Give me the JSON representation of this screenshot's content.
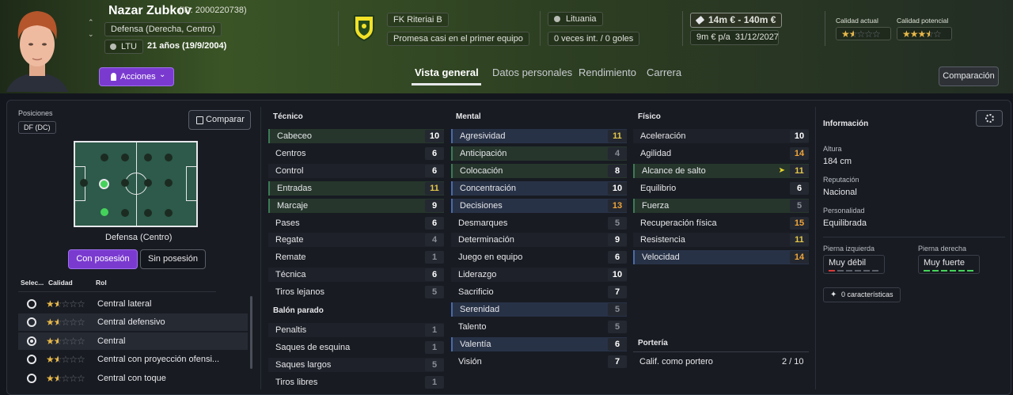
{
  "player": {
    "name": "Nazar Zubkov",
    "id": "(ID: 2000220738)",
    "position": "Defensa (Derecha, Centro)",
    "nation": "LTU",
    "age": "21 años (19/9/2004)",
    "actions": "Acciones"
  },
  "club": {
    "name": "FK Riteriai B",
    "status": "Promesa casi en el primer equipo"
  },
  "country": {
    "name": "Lituania",
    "caps": "0 veces int. / 0 goles"
  },
  "value": {
    "range": "14m € - 140m €",
    "wage": "9m € p/a",
    "expiry": "31/12/2027"
  },
  "ability": {
    "current_label": "Calidad actual",
    "current": 1.5,
    "potential_label": "Calidad potencial",
    "potential": 3.5
  },
  "tabs": [
    "Vista general",
    "Datos personales",
    "Rendimiento",
    "Carrera"
  ],
  "compare_btn": "Comparación",
  "left": {
    "positions_label": "Posiciones",
    "position_badge": "DF (DC)",
    "compare": "Comparar",
    "role_label": "Defensa (Centro)",
    "in_possession": "Con posesión",
    "out_possession": "Sin posesión",
    "cols": [
      "Selec...",
      "Calidad",
      "Rol"
    ],
    "roles": [
      {
        "name": "Central lateral",
        "stars": 1.5,
        "selected": false
      },
      {
        "name": "Central defensivo",
        "stars": 1.5,
        "selected": false
      },
      {
        "name": "Central",
        "stars": 1.5,
        "selected": true
      },
      {
        "name": "Central con proyección ofensi...",
        "stars": 1.5,
        "selected": false
      },
      {
        "name": "Central con toque",
        "stars": 1.5,
        "selected": false
      }
    ]
  },
  "technical": {
    "title": "Técnico",
    "attrs": [
      [
        "Cabeceo",
        10
      ],
      [
        "Centros",
        6
      ],
      [
        "Control",
        6
      ],
      [
        "Entradas",
        11
      ],
      [
        "Marcaje",
        9
      ],
      [
        "Pases",
        6
      ],
      [
        "Regate",
        4
      ],
      [
        "Remate",
        1
      ],
      [
        "Técnica",
        6
      ],
      [
        "Tiros lejanos",
        5
      ]
    ]
  },
  "setpieces": {
    "title": "Balón parado",
    "attrs": [
      [
        "Penaltis",
        1
      ],
      [
        "Saques de esquina",
        1
      ],
      [
        "Saques largos",
        5
      ],
      [
        "Tiros libres",
        1
      ]
    ]
  },
  "mental": {
    "title": "Mental",
    "attrs": [
      [
        "Agresividad",
        11
      ],
      [
        "Anticipación",
        4
      ],
      [
        "Colocación",
        8
      ],
      [
        "Concentración",
        10
      ],
      [
        "Decisiones",
        13
      ],
      [
        "Desmarques",
        5
      ],
      [
        "Determinación",
        9
      ],
      [
        "Juego en equipo",
        6
      ],
      [
        "Liderazgo",
        10
      ],
      [
        "Sacrificio",
        7
      ],
      [
        "Serenidad",
        5
      ],
      [
        "Talento",
        5
      ],
      [
        "Valentía",
        6
      ],
      [
        "Visión",
        7
      ]
    ]
  },
  "physical": {
    "title": "Físico",
    "attrs": [
      [
        "Aceleración",
        10
      ],
      [
        "Agilidad",
        14
      ],
      [
        "Alcance de salto",
        11
      ],
      [
        "Equilibrio",
        6
      ],
      [
        "Fuerza",
        5
      ],
      [
        "Recuperación física",
        15
      ],
      [
        "Resistencia",
        11
      ],
      [
        "Velocidad",
        14
      ]
    ]
  },
  "goalkeeping": {
    "title": "Portería",
    "label": "Calif. como portero",
    "value": "2 / 10"
  },
  "info": {
    "title": "Información",
    "height_label": "Altura",
    "height": "184 cm",
    "rep_label": "Reputación",
    "rep": "Nacional",
    "pers_label": "Personalidad",
    "pers": "Equilibrada",
    "left_foot_label": "Pierna izquierda",
    "left_foot": "Muy débil",
    "right_foot_label": "Pierna derecha",
    "right_foot": "Muy fuerte",
    "traits": "0 características"
  }
}
